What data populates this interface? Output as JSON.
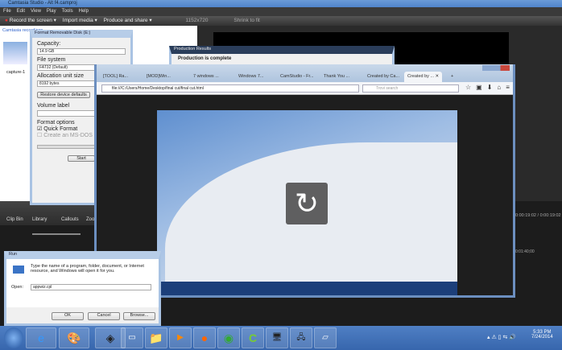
{
  "camtasia": {
    "title": "Camtasia Studio - Alt f4.camproj",
    "menu": [
      "File",
      "Edit",
      "View",
      "Play",
      "Tools",
      "Help"
    ],
    "toolbar": {
      "record": "Record the screen",
      "import": "Import media",
      "produce": "Produce and share",
      "size": "1152x720",
      "zoom": "Shrink to fit"
    },
    "breadcrumb": "Camtasia recordings",
    "clip_name": "capture-1",
    "tabs": [
      "Clip Bin",
      "Library",
      "Callouts",
      "Zoom-n-Pan"
    ],
    "time": "0:00:19:02 / 0:00:19:02",
    "timeline_mark": "0:01:40;00"
  },
  "format_dialog": {
    "title": "Format Removable Disk (E:)",
    "capacity_label": "Capacity:",
    "capacity": "14.9 GB",
    "fs_label": "File system",
    "fs": "FAT32 (Default)",
    "alloc_label": "Allocation unit size",
    "alloc": "8192 bytes",
    "restore": "Restore device defaults",
    "volume_label": "Volume label",
    "options_label": "Format options",
    "quick": "Quick Format",
    "msdos": "Create an MS-DOS startup disk",
    "start": "Start",
    "quick_checked": true,
    "msdos_checked": false
  },
  "production": {
    "title": "Production Results",
    "text": "Production is complete"
  },
  "browser": {
    "tabs": [
      "[TOOL] Ra...",
      "[MOD]Win...",
      "7 windows ...",
      "Windows 7...",
      "CamStudio - Fr...",
      "Thank You ...",
      "Created by Ca...",
      "Created by ..."
    ],
    "url": "file:///C:/Users/Home/Desktop/final cut/final cut.html",
    "search_placeholder": "Trovi search"
  },
  "run_dialog": {
    "title": "Run",
    "description": "Type the name of a program, folder, document, or Internet resource, and Windows will open it for you.",
    "open_label": "Open:",
    "value": "appwiz.cpl",
    "ok": "OK",
    "cancel": "Cancel",
    "browse": "Browse..."
  },
  "taskbar": {
    "apps": [
      "internet-explorer",
      "paint",
      "search-tool",
      "virtualbox",
      "remote-desktop",
      "explorer",
      "media-player",
      "firefox",
      "chrome",
      "camtasia",
      "display",
      "network",
      "remote-app"
    ],
    "time": "5:33 PM",
    "date": "7/24/2014"
  },
  "accent": "#3766ad"
}
